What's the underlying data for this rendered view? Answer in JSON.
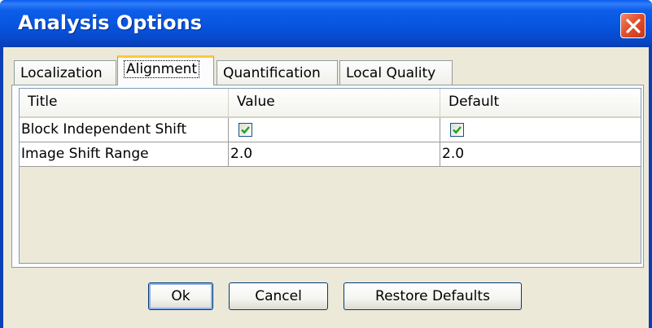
{
  "window": {
    "title": "Analysis Options",
    "close_icon": "close-icon"
  },
  "tabs": [
    {
      "label": "Localization",
      "selected": false
    },
    {
      "label": "Alignment",
      "selected": true
    },
    {
      "label": "Quantification",
      "selected": false
    },
    {
      "label": "Local Quality",
      "selected": false
    }
  ],
  "table": {
    "columns": [
      "Title",
      "Value",
      "Default"
    ],
    "rows": [
      {
        "title": "Block Independent Shift",
        "value_checked": true,
        "default_checked": true
      },
      {
        "title": "Image Shift Range",
        "value": "2.0",
        "default": "2.0"
      }
    ]
  },
  "buttons": {
    "ok": "Ok",
    "cancel": "Cancel",
    "restore": "Restore Defaults"
  },
  "colors": {
    "titlebar": "#0754e0",
    "close": "#e2512d",
    "checkmark": "#21a121",
    "tab_highlight": "#ffc83c"
  }
}
